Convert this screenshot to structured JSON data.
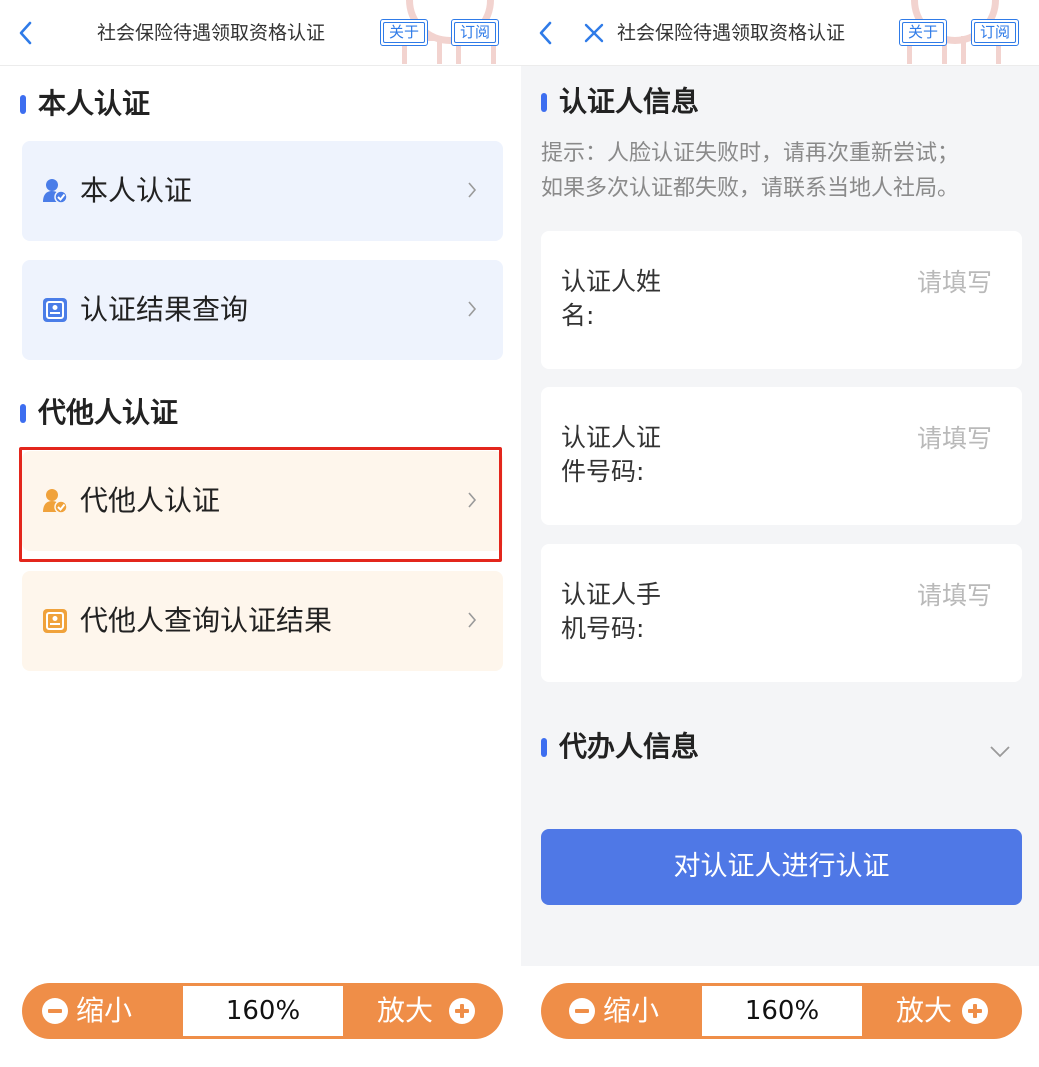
{
  "left_screen": {
    "title": "社会保险待遇领取资格认证",
    "about_label": "关于",
    "subscribe_label": "订阅",
    "self_section": {
      "heading": "本人认证",
      "items": [
        {
          "label": "本人认证",
          "icon": "person-check-icon"
        },
        {
          "label": "认证结果查询",
          "icon": "id-card-icon"
        }
      ]
    },
    "proxy_section": {
      "heading": "代他人认证",
      "items": [
        {
          "label": "代他人认证",
          "icon": "person-check-icon"
        },
        {
          "label": "代他人查询认证结果",
          "icon": "id-card-icon"
        }
      ]
    },
    "zoom": {
      "zoom_out_label": "缩小",
      "value": "160%",
      "zoom_in_label": "放大"
    }
  },
  "right_screen": {
    "title": "社会保险待遇领取资格认证",
    "about_label": "关于",
    "subscribe_label": "订阅",
    "certifier_heading": "认证人信息",
    "hint_line1": "提示：人脸认证失败时，请再次重新尝试；",
    "hint_line2": "如果多次认证都失败，请联系当地人社局。",
    "fields": [
      {
        "label_line1": "认证人姓",
        "label_line2": "名:",
        "placeholder": "请填写"
      },
      {
        "label_line1": "认证人证",
        "label_line2": "件号码:",
        "placeholder": "请填写"
      },
      {
        "label_line1": "认证人手",
        "label_line2": "机号码:",
        "placeholder": "请填写"
      }
    ],
    "agent_heading": "代办人信息",
    "submit_label": "对认证人进行认证",
    "zoom": {
      "zoom_out_label": "缩小",
      "value": "160%",
      "zoom_in_label": "放大"
    }
  },
  "colors": {
    "accent_blue": "#3d6ef0",
    "button_blue": "#4f78e6",
    "zoom_orange": "#ef8e48",
    "highlight_red": "#e3261c",
    "card_blue_bg": "#eef3fd",
    "card_orange_bg": "#fef6ec"
  }
}
